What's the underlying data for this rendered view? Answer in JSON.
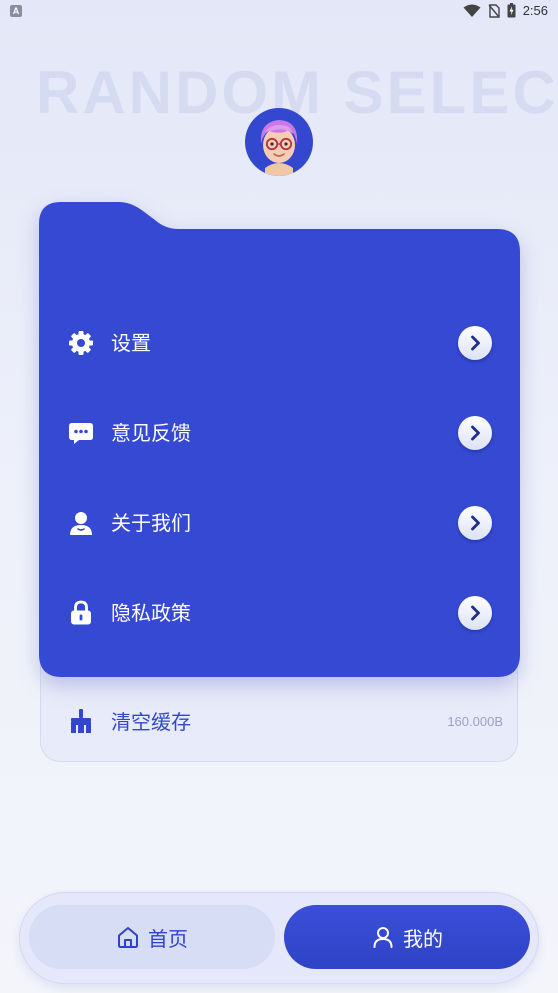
{
  "status_bar": {
    "time": "2:56",
    "app_icon_letter": "A",
    "icons": [
      "wifi-icon",
      "no-sim-icon",
      "battery-charging-icon"
    ]
  },
  "watermark": "RANDOM SELECT",
  "profile": {
    "avatar_icon": "avatar-face-icon"
  },
  "menu": {
    "items": [
      {
        "label": "设置",
        "icon": "gear-icon"
      },
      {
        "label": "意见反馈",
        "icon": "chat-bubble-icon"
      },
      {
        "label": "关于我们",
        "icon": "person-icon"
      },
      {
        "label": "隐私政策",
        "icon": "lock-icon"
      }
    ]
  },
  "cache": {
    "label": "清空缓存",
    "value": "160.000B",
    "icon": "broom-icon"
  },
  "bottom_nav": {
    "home": {
      "label": "首页",
      "icon": "home-icon"
    },
    "mine": {
      "label": "我的",
      "icon": "user-icon",
      "active": true
    }
  },
  "colors": {
    "primary": "#3549D3",
    "background": "#EDF0FA",
    "chevron_bg": "#F2F4FC",
    "muted_text": "#9AA1C2"
  }
}
